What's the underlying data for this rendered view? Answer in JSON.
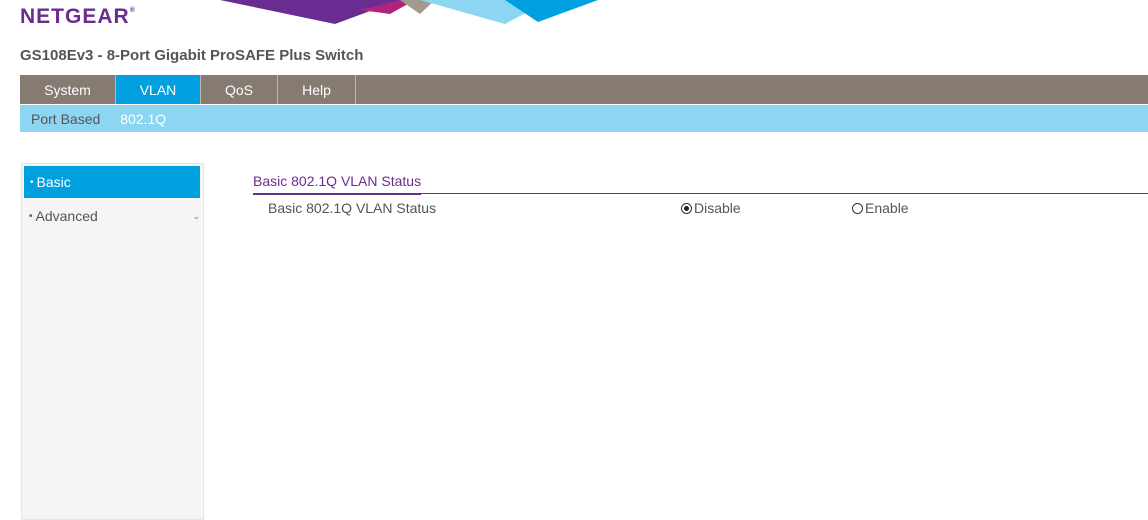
{
  "brand": {
    "logo_text": "NETGEAR",
    "logo_mark": "®"
  },
  "product_title": "GS108Ev3 - 8-Port Gigabit ProSAFE Plus Switch",
  "main_nav": [
    {
      "label": "System",
      "active": false
    },
    {
      "label": "VLAN",
      "active": true
    },
    {
      "label": "QoS",
      "active": false
    },
    {
      "label": "Help",
      "active": false
    }
  ],
  "sub_nav": [
    {
      "label": "Port Based",
      "active": false
    },
    {
      "label": "802.1Q",
      "active": true
    }
  ],
  "sidebar": {
    "items": [
      {
        "label": "Basic",
        "active": true
      },
      {
        "label": "Advanced",
        "active": false,
        "expandable": true
      }
    ]
  },
  "content": {
    "section_title": "Basic 802.1Q VLAN Status",
    "row_label": "Basic 802.1Q VLAN Status",
    "options": [
      {
        "label": "Disable",
        "selected": true
      },
      {
        "label": "Enable",
        "selected": false
      }
    ]
  },
  "colors": {
    "brand_purple": "#6b2c91",
    "nav_bg": "#857b70",
    "active_blue": "#009fdf",
    "subnav_bg": "#8dd6f2"
  }
}
